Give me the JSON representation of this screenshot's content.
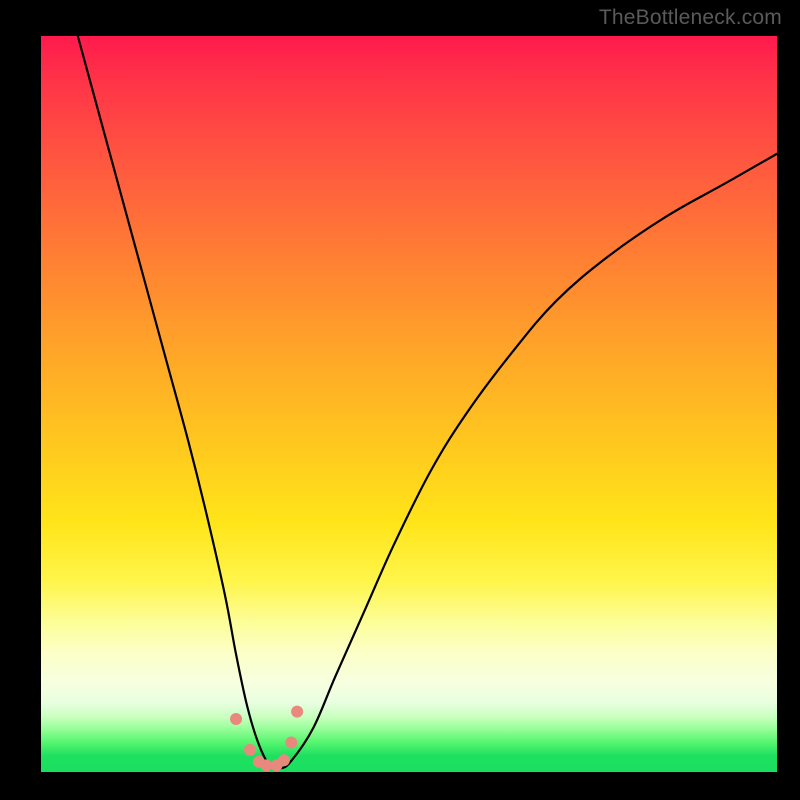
{
  "watermark": "TheBottleneck.com",
  "chart_data": {
    "type": "line",
    "title": "",
    "xlabel": "",
    "ylabel": "",
    "xlim": [
      0,
      100
    ],
    "ylim": [
      0,
      100
    ],
    "series": [
      {
        "name": "bottleneck-curve",
        "x": [
          5,
          8,
          11,
          14,
          17,
          20,
          22.5,
          25,
          26.5,
          28,
          29.5,
          31,
          32.5,
          34,
          37,
          40,
          44,
          48,
          53,
          58,
          64,
          70,
          77,
          85,
          93,
          100
        ],
        "values": [
          100,
          89,
          78,
          67,
          56,
          45,
          35,
          24,
          16,
          9,
          4,
          1,
          0.5,
          1.5,
          6,
          13,
          22,
          31,
          41,
          49,
          57,
          64,
          70,
          75.5,
          80,
          84
        ]
      }
    ],
    "markers": {
      "name": "dots",
      "x": [
        26.5,
        28.4,
        29.6,
        30.6,
        32.0,
        33.0,
        34.0,
        34.8
      ],
      "values": [
        7.2,
        3.0,
        1.4,
        0.9,
        0.9,
        1.6,
        4.0,
        8.2
      ],
      "color": "#e9897e",
      "radius_px": 6
    },
    "colors": {
      "curve": "#000000",
      "background_top": "#ff1a4d",
      "background_bottom": "#1adf5e",
      "frame": "#000000"
    }
  }
}
